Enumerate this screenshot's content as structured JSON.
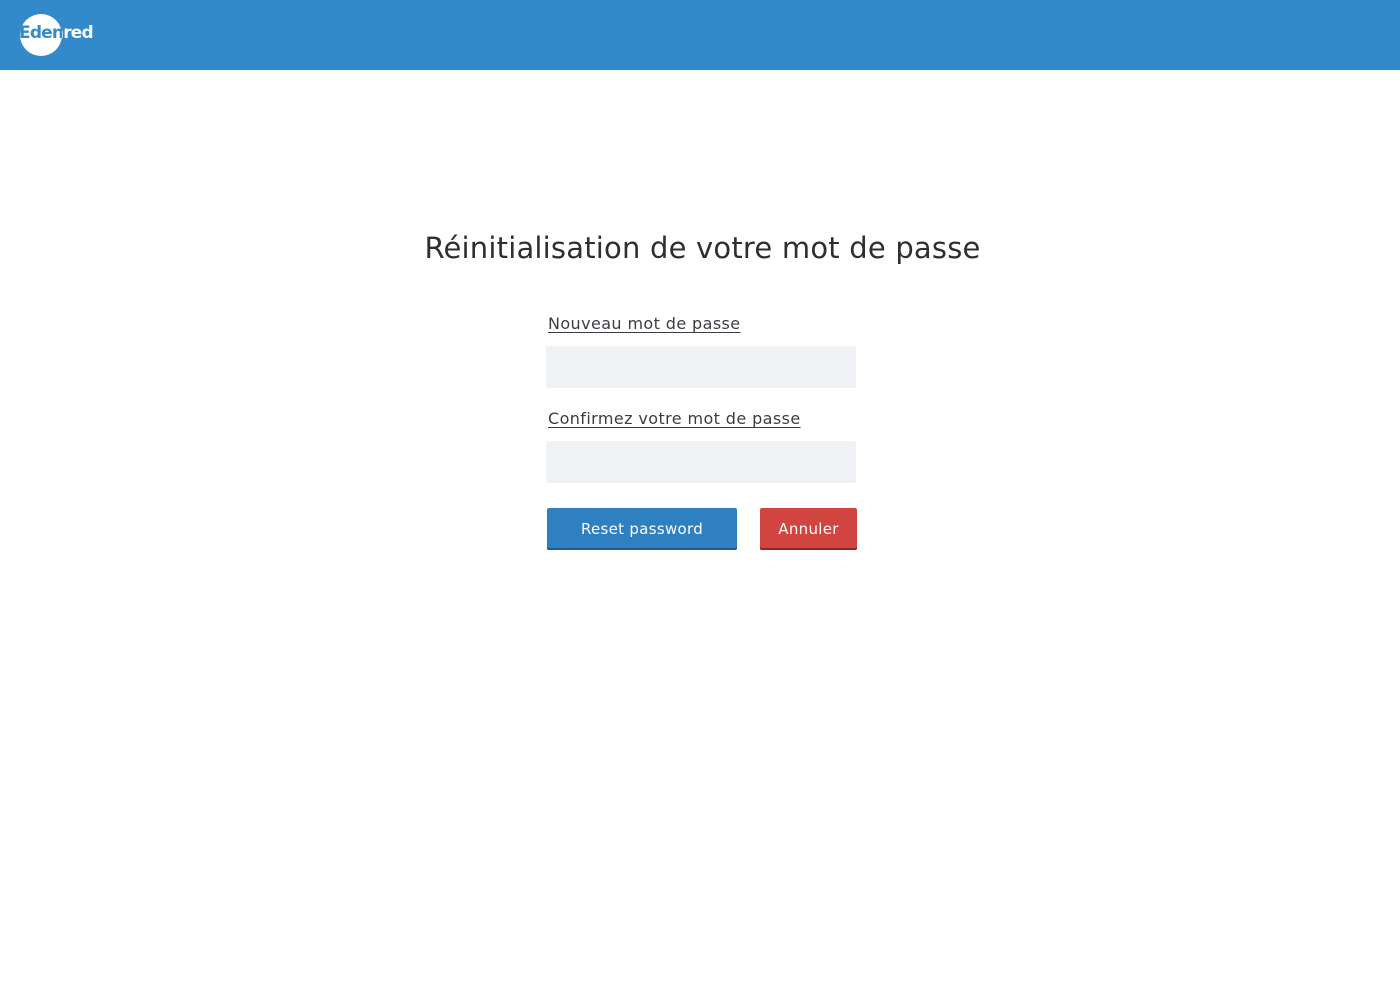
{
  "header": {
    "brand_name": "Edenred",
    "brand_color": "#338aca"
  },
  "page": {
    "title": "Réinitialisation de votre mot de passe"
  },
  "form": {
    "new_password_label": "Nouveau mot de passe",
    "new_password_value": "",
    "confirm_password_label": "Confirmez votre mot de passe",
    "confirm_password_value": "",
    "reset_button_label": "Reset password",
    "cancel_button_label": "Annuler",
    "input_background": "#f0f1f5",
    "reset_button_color": "#2f80c0",
    "cancel_button_color": "#d14440"
  }
}
